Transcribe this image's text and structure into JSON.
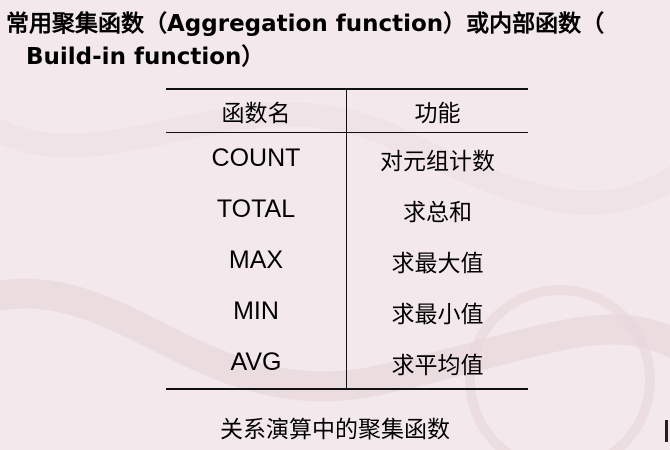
{
  "heading": {
    "line1": "常用聚集函数（Aggregation function）或内部函数（",
    "line2": "Build-in function）"
  },
  "table": {
    "headers": [
      "函数名",
      "功能"
    ],
    "rows": [
      [
        "COUNT",
        "对元组计数"
      ],
      [
        "TOTAL",
        "求总和"
      ],
      [
        "MAX",
        "求最大值"
      ],
      [
        "MIN",
        "求最小值"
      ],
      [
        "AVG",
        "求平均值"
      ]
    ]
  },
  "caption": "关系演算中的聚集函数",
  "colors": {
    "background": "#f3e9ec",
    "rule": "#111111"
  }
}
